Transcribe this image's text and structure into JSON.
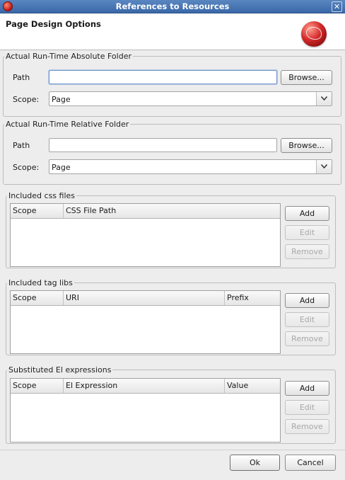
{
  "window": {
    "title": "References to Resources"
  },
  "banner": {
    "title": "Page Design Options"
  },
  "absolute_folder": {
    "legend": "Actual Run-Time Absolute Folder",
    "path_label": "Path",
    "path_value": "",
    "browse_label": "Browse...",
    "scope_label": "Scope:",
    "scope_value": "Page"
  },
  "relative_folder": {
    "legend": "Actual Run-Time Relative Folder",
    "path_label": "Path",
    "path_value": "",
    "browse_label": "Browse...",
    "scope_label": "Scope:",
    "scope_value": "Page"
  },
  "css_files": {
    "legend": "Included css files",
    "columns": [
      "Scope",
      "CSS File Path"
    ],
    "add_label": "Add",
    "edit_label": "Edit",
    "remove_label": "Remove"
  },
  "tag_libs": {
    "legend": "Included tag libs",
    "columns": [
      "Scope",
      "URI",
      "Prefix"
    ],
    "add_label": "Add",
    "edit_label": "Edit",
    "remove_label": "Remove"
  },
  "el_expressions": {
    "legend": "Substituted El expressions",
    "columns": [
      "Scope",
      "El Expression",
      "Value"
    ],
    "add_label": "Add",
    "edit_label": "Edit",
    "remove_label": "Remove"
  },
  "footer": {
    "ok_label": "Ok",
    "cancel_label": "Cancel"
  }
}
